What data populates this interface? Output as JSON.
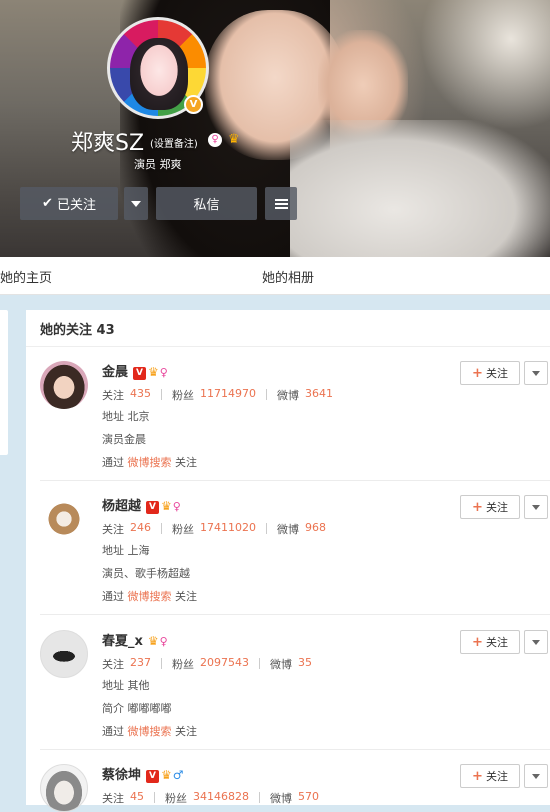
{
  "profile": {
    "nickname": "郑爽SZ",
    "remark_link": "(设置备注)",
    "intro": "演员 郑爽",
    "verify_icon": "verified-v-icon",
    "buttons": {
      "followed": "已关注",
      "message": "私信"
    }
  },
  "tabs": [
    {
      "label": "她的主页"
    },
    {
      "label": "她的相册"
    }
  ],
  "panel": {
    "title": "她的关注 43"
  },
  "labels": {
    "follow": "关注",
    "fans": "粉丝",
    "weibo": "微博",
    "address": "地址",
    "via": "通过",
    "via_link": "微博搜索",
    "via_suffix": "关注",
    "intro": "简介",
    "follow_button": "关注"
  },
  "users": [
    {
      "name": "金晨",
      "following": "435",
      "fans": "11714970",
      "weibo": "3641",
      "address": "北京",
      "desc": "演员金晨",
      "gender": "female"
    },
    {
      "name": "杨超越",
      "following": "246",
      "fans": "17411020",
      "weibo": "968",
      "address": "上海",
      "desc": "演员、歌手杨超越",
      "gender": "female"
    },
    {
      "name": "春夏_x",
      "following": "237",
      "fans": "2097543",
      "weibo": "35",
      "address": "其他",
      "intro_text": "嘟嘟嘟嘟",
      "gender": "female"
    },
    {
      "name": "蔡徐坤",
      "following": "45",
      "fans": "34146828",
      "weibo": "570",
      "gender": "male"
    }
  ],
  "colors": {
    "accent": "#eb7350",
    "verified_red": "#e2281b",
    "crown": "#f7a11a",
    "female": "#e8459b",
    "male": "#2d8de6"
  }
}
